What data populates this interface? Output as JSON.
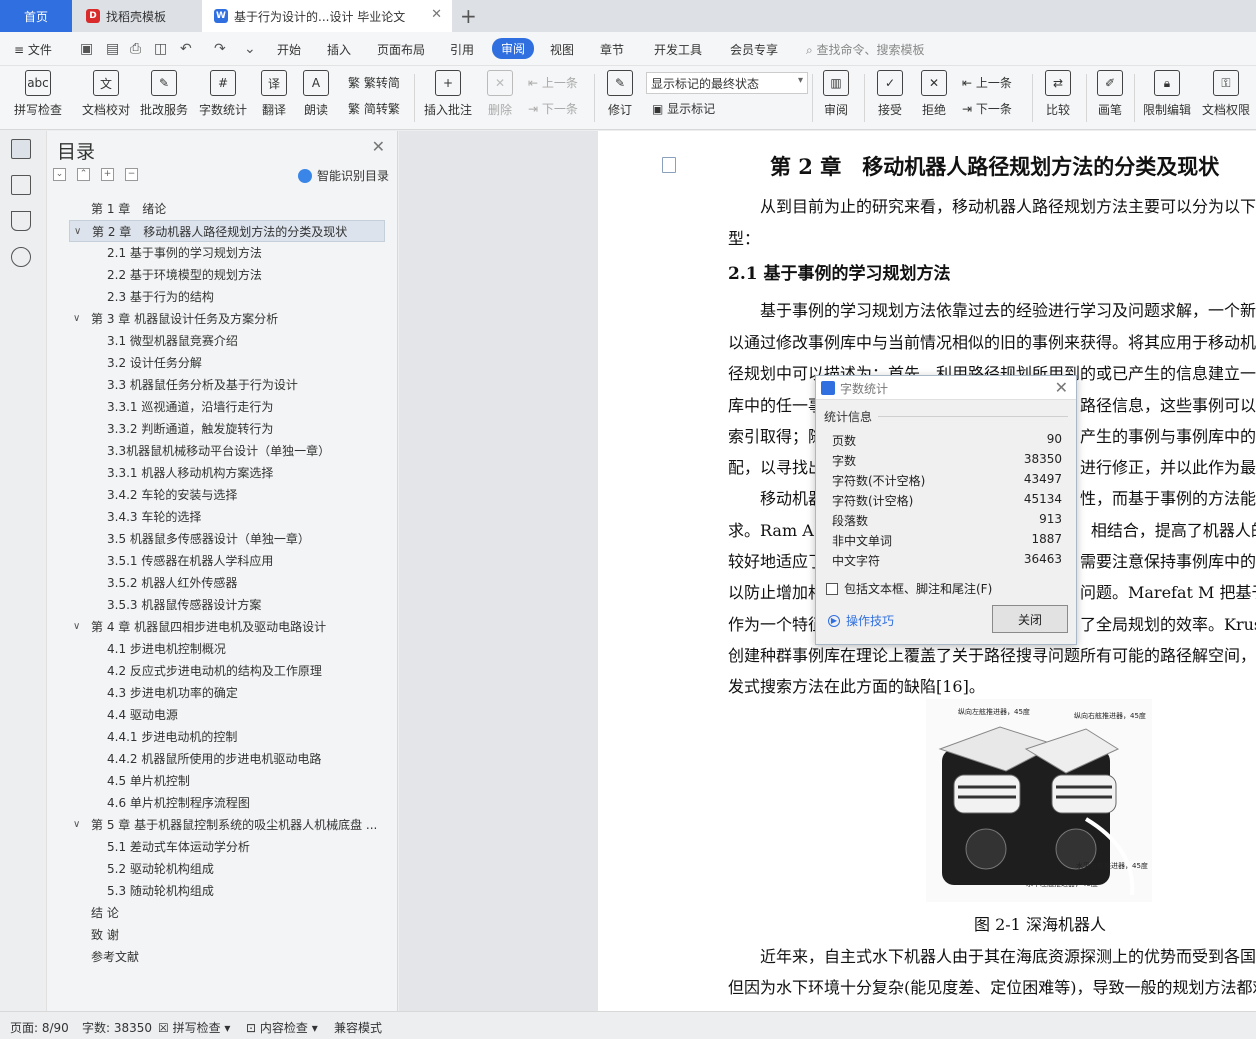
{
  "tabs": {
    "home": "首页",
    "template": "找稻壳模板",
    "doc": "基于行为设计的...设计 毕业论文"
  },
  "menu": {
    "file": "文件",
    "items": [
      "开始",
      "插入",
      "页面布局",
      "引用",
      "审阅",
      "视图",
      "章节",
      "开发工具",
      "会员专享"
    ],
    "search": "查找命令、搜索模板"
  },
  "ribbon": {
    "spell": "拼写检查",
    "doc_check": "文档校对",
    "batch": "批改服务",
    "word_count": "字数统计",
    "translate": "翻译",
    "read": "朗读",
    "to_trad": "繁转简",
    "to_simp": "简转繁",
    "insert_comment": "插入批注",
    "delete": "删除",
    "prev": "上一条",
    "next": "下一条",
    "revise": "修订",
    "markup_mode": "显示标记的最终状态",
    "show_markup": "显示标记",
    "review": "审阅",
    "accept": "接受",
    "reject": "拒绝",
    "prev2": "上一条",
    "next2": "下一条",
    "compare": "比较",
    "pen": "画笔",
    "restrict": "限制编辑",
    "perm": "文档权限"
  },
  "toc": {
    "title": "目录",
    "smart": "智能识别目录",
    "items": [
      {
        "text": "第 1 章　绪论",
        "level": 1,
        "caret": ""
      },
      {
        "text": "第 2 章　移动机器人路径规划方法的分类及现状",
        "level": 1,
        "caret": "v"
      },
      {
        "text": "2.1  基于事例的学习规划方法",
        "level": 2,
        "caret": ""
      },
      {
        "text": "2.2  基于环境模型的规划方法",
        "level": 2,
        "caret": ""
      },
      {
        "text": "2.3  基于行为的结构",
        "level": 2,
        "caret": ""
      },
      {
        "text": "第 3 章  机器鼠设计任务及方案分析",
        "level": 1,
        "caret": "v"
      },
      {
        "text": "3.1  微型机器鼠竞赛介绍",
        "level": 2,
        "caret": ""
      },
      {
        "text": "3.2  设计任务分解",
        "level": 2,
        "caret": ""
      },
      {
        "text": "3.3  机器鼠任务分析及基于行为设计",
        "level": 2,
        "caret": ""
      },
      {
        "text": "3.3.1  巡视通道，沿墙行走行为",
        "level": 2,
        "caret": ""
      },
      {
        "text": "3.3.2  判断通道，触发旋转行为",
        "level": 2,
        "caret": ""
      },
      {
        "text": "3.3机器鼠机械移动平台设计（单独一章）",
        "level": 2,
        "caret": ""
      },
      {
        "text": "3.3.1  机器人移动机构方案选择",
        "level": 2,
        "caret": ""
      },
      {
        "text": "3.4.2  车轮的安装与选择",
        "level": 2,
        "caret": ""
      },
      {
        "text": "3.4.3  车轮的选择",
        "level": 2,
        "caret": ""
      },
      {
        "text": "3.5  机器鼠多传感器设计（单独一章）",
        "level": 2,
        "caret": ""
      },
      {
        "text": "3.5.1  传感器在机器人学科应用",
        "level": 2,
        "caret": ""
      },
      {
        "text": "3.5.2  机器人红外传感器",
        "level": 2,
        "caret": ""
      },
      {
        "text": "3.5.3 机器鼠传感器设计方案",
        "level": 2,
        "caret": ""
      },
      {
        "text": "第 4 章  机器鼠四相步进电机及驱动电路设计",
        "level": 1,
        "caret": "v"
      },
      {
        "text": "4.1  步进电机控制概况",
        "level": 2,
        "caret": ""
      },
      {
        "text": "4.2  反应式步进电动机的结构及工作原理",
        "level": 2,
        "caret": ""
      },
      {
        "text": "4.3  步进电机功率的确定",
        "level": 2,
        "caret": ""
      },
      {
        "text": "4.4  驱动电源",
        "level": 2,
        "caret": ""
      },
      {
        "text": "4.4.1  步进电动机的控制",
        "level": 2,
        "caret": ""
      },
      {
        "text": "4.4.2  机器鼠所使用的步进电机驱动电路",
        "level": 2,
        "caret": ""
      },
      {
        "text": "4.5  单片机控制",
        "level": 2,
        "caret": ""
      },
      {
        "text": "4.6  单片机控制程序流程图",
        "level": 2,
        "caret": ""
      },
      {
        "text": "第 5 章  基于机器鼠控制系统的吸尘机器人机械底盘 ...",
        "level": 1,
        "caret": "v"
      },
      {
        "text": "5.1  差动式车体运动学分析",
        "level": 2,
        "caret": ""
      },
      {
        "text": "5.2  驱动轮机构组成",
        "level": 2,
        "caret": ""
      },
      {
        "text": "5.3  随动轮机构组成",
        "level": 2,
        "caret": ""
      },
      {
        "text": "结  论",
        "level": 1,
        "caret": ""
      },
      {
        "text": "致  谢",
        "level": 1,
        "caret": ""
      },
      {
        "text": "参考文献",
        "level": 1,
        "caret": ""
      }
    ],
    "selected_index": 1
  },
  "document": {
    "chapter_title": "第 2 章　移动机器人路径规划方法的分类及现状",
    "lines": [
      "　　从到目前为止的研究来看，移动机器人路径规划方法主要可以分为以下",
      "型：",
      "2.1  基于事例的学习规划方法",
      "　　基于事例的学习规划方法依靠过去的经验进行学习及问题求解，一个新的",
      "以通过修改事例库中与当前情况相似的旧的事例来获得。将其应用于移动机器",
      "径规划中可以描述为：首先，利用路径规划所用到的或已产生的信息建立一个",
      "库中的任一事例　　　　　　　　　　　　　　　路径信息，这些事例可以通过",
      "索引取得；随　　　　　　　　　　　　　　　　产生的事例与事例库中的事例",
      "配，以寻找出　　　　　　　　　　　　　　　　进行修正，并以此作为最后",
      "　　移动机器　　　　　　　　　　　　　　　　性，而基于事例的方法能满足",
      "求。Ram A 将　　　　　　　　　　　　　　　　相结合，提高了机器人的自适",
      "较好地适应了　　　　　　　　　　　　　　　　需要注意保持事例库中的事",
      "以防止增加相　　　　　　　　　　　　　　　　问题。Marefat M 把基于事例",
      "作为一个特征　　　　　　　　　　　　　　　　了全局规划的效率。Krusmaa",
      "创建种群事例库在理论上覆盖了关于路径搜寻问题所有可能的路径解空间，克",
      "发式搜索方法在此方面的缺陷[16]。"
    ],
    "figure_labels": [
      "纵向左舷推进器，45度",
      "纵向右舷推进器，45度",
      "水平右舷推进器，45度",
      "水平左舷推进器，45度"
    ],
    "figure_caption": "图 2-1  深海机器人",
    "after_lines": [
      "　　近年来，自主式水下机器人由于其在海底资源探测上的优势而受到各国",
      "但因为水下环境十分复杂(能见度差、定位困难等)，导致一般的规划方法都难"
    ]
  },
  "dialog": {
    "title": "字数统计",
    "group": "统计信息",
    "stats": [
      {
        "k": "页数",
        "v": "90"
      },
      {
        "k": "字数",
        "v": "38350"
      },
      {
        "k": "字符数(不计空格)",
        "v": "43497"
      },
      {
        "k": "字符数(计空格)",
        "v": "45134"
      },
      {
        "k": "段落数",
        "v": "913"
      },
      {
        "k": "非中文单词",
        "v": "1887"
      },
      {
        "k": "中文字符",
        "v": "36463"
      }
    ],
    "include_label": "包括文本框、脚注和尾注(F)",
    "include_checked": false,
    "tips": "操作技巧",
    "close": "关闭"
  },
  "status": {
    "page": "页面: 8/90",
    "words": "字数: 38350",
    "spell": "拼写检查",
    "content": "内容检查",
    "compat": "兼容模式"
  }
}
